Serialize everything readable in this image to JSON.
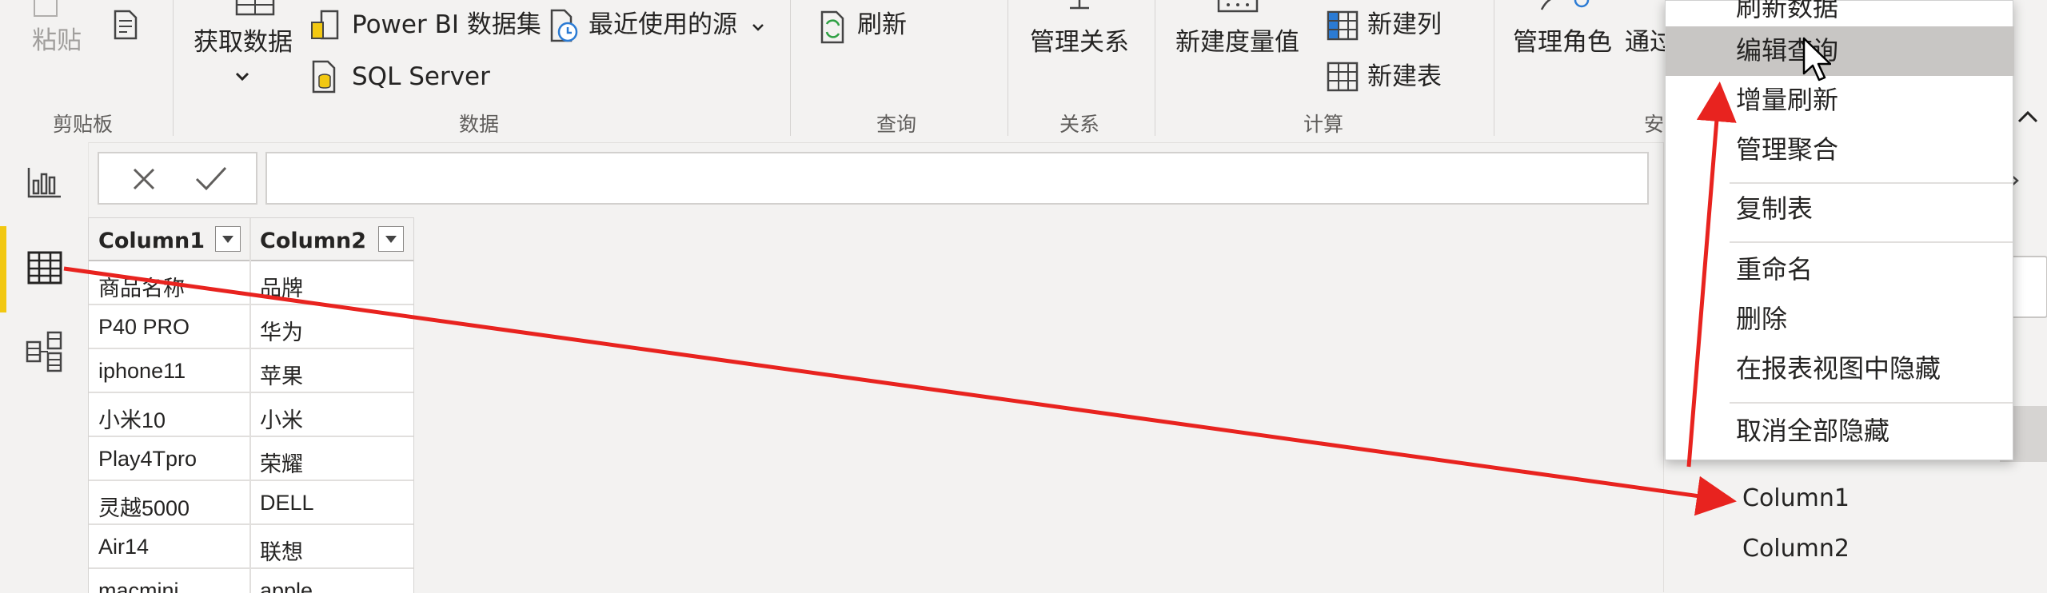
{
  "ribbon": {
    "clipboard": {
      "paste_label": "粘贴",
      "group_title": "剪贴板"
    },
    "data": {
      "get_data_label": "获取数据",
      "powerbi_dataset_label": "Power BI 数据集",
      "recent_sources_label": "最近使用的源",
      "sql_server_label": "SQL Server",
      "group_title": "数据"
    },
    "query": {
      "refresh_label": "刷新",
      "group_title": "查询"
    },
    "relationships": {
      "manage_label": "管理关系",
      "group_title": "关系"
    },
    "calculations": {
      "new_measure_label": "新建度量值",
      "new_column_label": "新建列",
      "new_table_label": "新建表",
      "group_title": "计算"
    },
    "security": {
      "manage_roles_label": "管理角色",
      "view_as_label": "通过",
      "group_title": "安"
    }
  },
  "grid": {
    "columns": [
      "Column1",
      "Column2"
    ],
    "rows": [
      [
        "商品名称",
        "品牌"
      ],
      [
        "P40 PRO",
        "华为"
      ],
      [
        "iphone11",
        "苹果"
      ],
      [
        "小米10",
        "小米"
      ],
      [
        "Play4Tpro",
        "荣耀"
      ],
      [
        "灵越5000",
        "DELL"
      ],
      [
        "Air14",
        "联想"
      ],
      [
        "macmini",
        "apple"
      ]
    ]
  },
  "context_menu": {
    "items": [
      {
        "label": "刷新数据"
      },
      {
        "label": "编辑查询",
        "highlighted": true
      },
      {
        "label": "增量刷新"
      },
      {
        "label": "管理聚合"
      },
      {
        "label": "复制表"
      },
      {
        "label": "重命名"
      },
      {
        "label": "删除"
      },
      {
        "label": "在报表视图中隐藏"
      },
      {
        "label": "取消全部隐藏"
      }
    ]
  },
  "fields_pane": {
    "fields": [
      "Column1",
      "Column2"
    ]
  },
  "colors": {
    "accent_yellow": "#f2c811",
    "annotation_red": "#e8231f",
    "menu_highlight": "#c8c6c4"
  }
}
